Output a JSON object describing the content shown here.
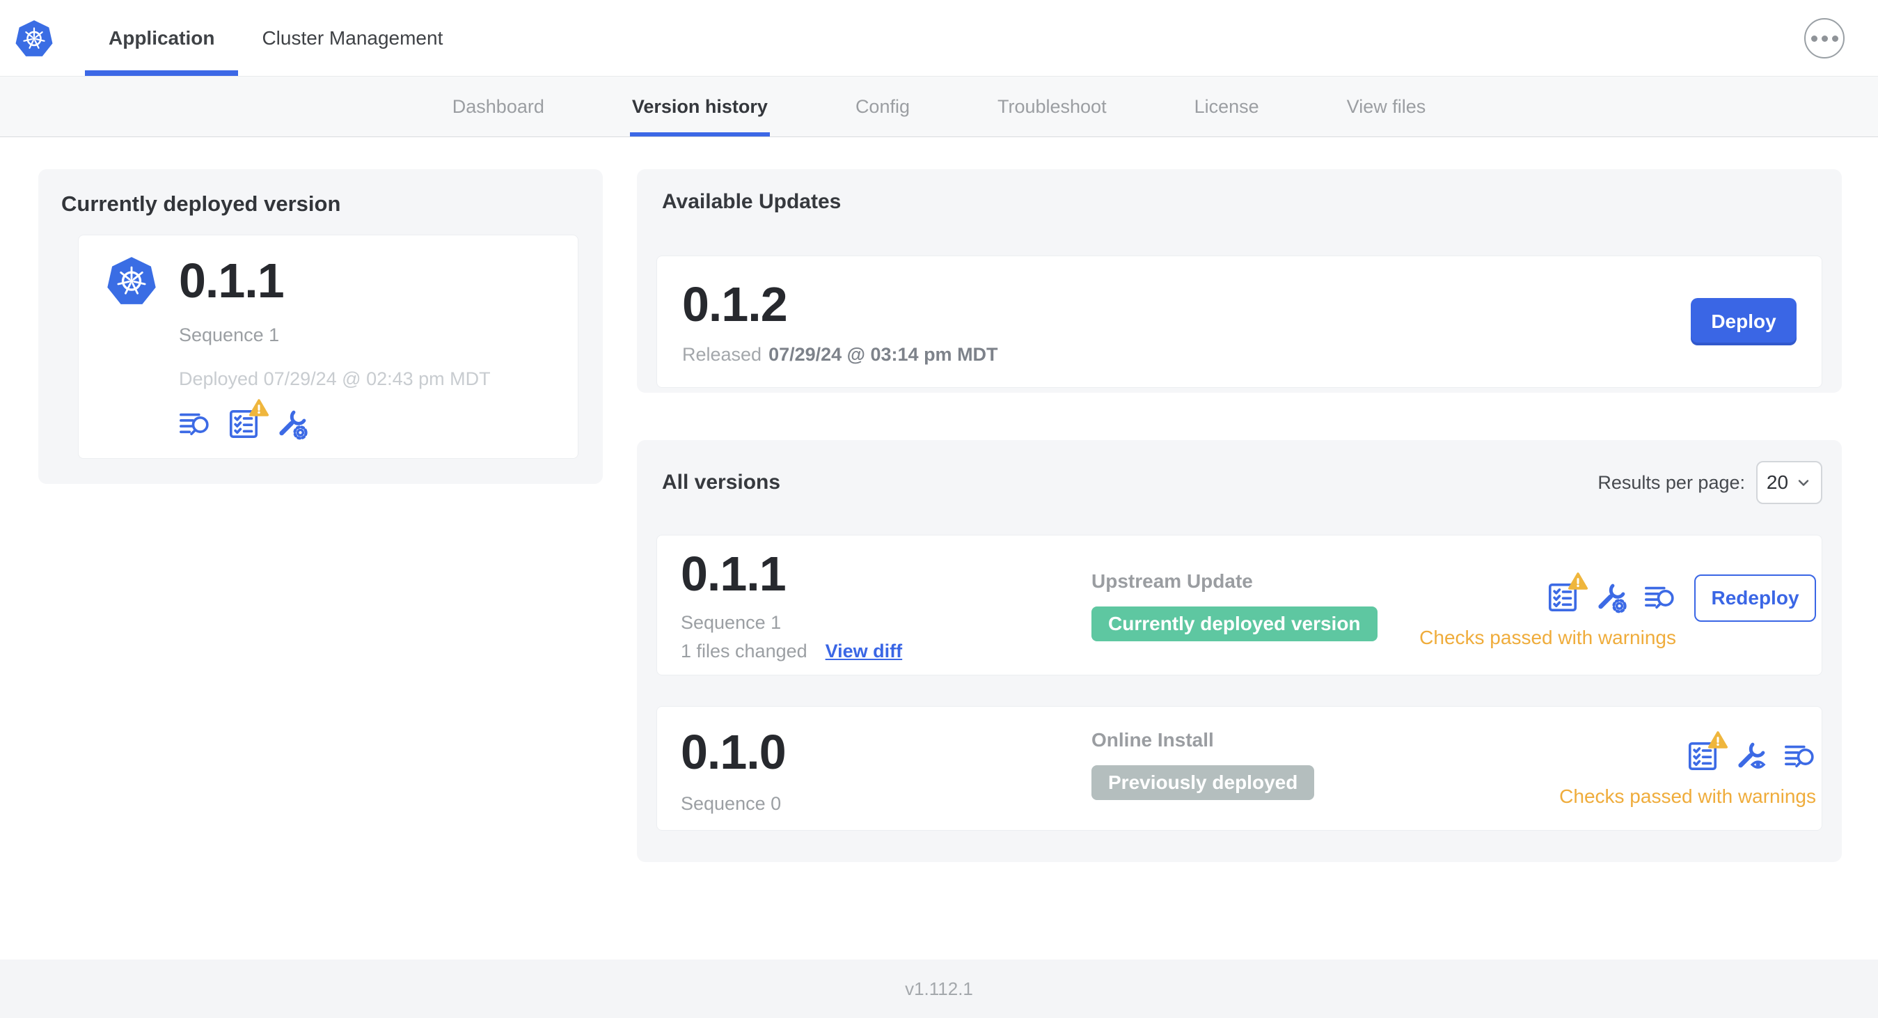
{
  "colors": {
    "accent_blue": "#3a66e5",
    "kubernetes_blue": "#3a6de4",
    "warning_amber": "#efb63d",
    "green_badge": "#5ec7a1",
    "gray_badge": "#b4bebe",
    "check_warning_text": "#efac3b"
  },
  "top_nav": {
    "tabs": [
      {
        "label": "Application",
        "active": true
      },
      {
        "label": "Cluster Management",
        "active": false
      }
    ]
  },
  "sub_nav": {
    "tabs": [
      "Dashboard",
      "Version history",
      "Config",
      "Troubleshoot",
      "License",
      "View files"
    ],
    "active_tab": "Version history"
  },
  "current_version_card": {
    "title": "Currently deployed version",
    "version": "0.1.1",
    "sequence": "Sequence 1",
    "deployed_at": "Deployed 07/29/24 @ 02:43 pm MDT",
    "icons": [
      "view-logs-icon",
      "preflight-checks-warning-icon",
      "edit-config-icon"
    ]
  },
  "available_updates": {
    "title": "Available Updates",
    "version": "0.1.2",
    "released_label": "Released",
    "released_at": "07/29/24 @ 03:14 pm MDT",
    "deploy_button": "Deploy"
  },
  "all_versions": {
    "title": "All versions",
    "results_per_page_label": "Results per page:",
    "results_per_page_value": "20",
    "rows": [
      {
        "version": "0.1.1",
        "sequence": "Sequence 1",
        "files_changed": "1 files changed",
        "view_diff_link": "View diff",
        "source": "Upstream Update",
        "status_badge": "Currently deployed version",
        "badge_color": "#5ec7a1",
        "check_status": "Checks passed with warnings",
        "action_button": "Redeploy",
        "icons": [
          "preflight-checks-warning-icon",
          "edit-config-icon",
          "view-logs-icon"
        ]
      },
      {
        "version": "0.1.0",
        "sequence": "Sequence 0",
        "source": "Online Install",
        "status_badge": "Previously deployed",
        "badge_color": "#b4bebe",
        "check_status": "Checks passed with warnings",
        "icons": [
          "preflight-checks-warning-icon",
          "view-config-icon",
          "view-logs-icon"
        ]
      }
    ]
  },
  "footer": {
    "app_version": "v1.112.1"
  }
}
